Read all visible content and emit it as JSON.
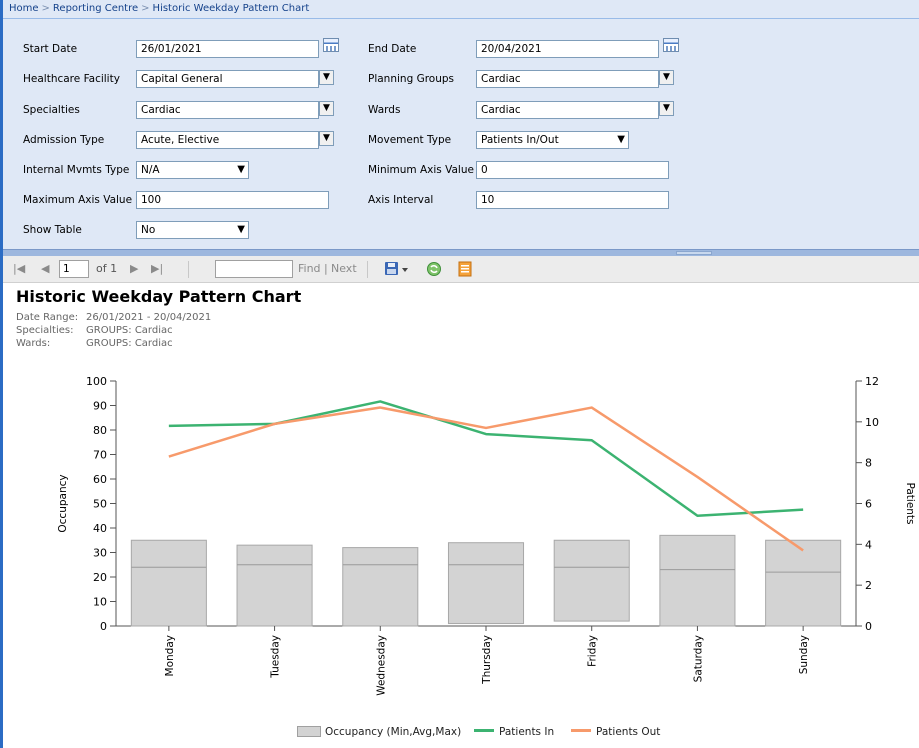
{
  "breadcrumb": [
    "Home",
    "Reporting Centre",
    "Historic Weekday Pattern Chart"
  ],
  "params": {
    "start_date": {
      "label": "Start Date",
      "value": "26/01/2021"
    },
    "end_date": {
      "label": "End Date",
      "value": "20/04/2021"
    },
    "healthcare_facility": {
      "label": "Healthcare Facility",
      "value": "Capital General"
    },
    "planning_groups": {
      "label": "Planning Groups",
      "value": "Cardiac"
    },
    "specialties": {
      "label": "Specialties",
      "value": "Cardiac"
    },
    "wards": {
      "label": "Wards",
      "value": "Cardiac"
    },
    "admission_type": {
      "label": "Admission Type",
      "value": "Acute, Elective"
    },
    "movement_type": {
      "label": "Movement Type",
      "value": "Patients In/Out"
    },
    "internal_mvmts_type": {
      "label": "Internal Mvmts Type",
      "value": "N/A"
    },
    "minimum_axis_value": {
      "label": "Minimum Axis Value",
      "value": "0"
    },
    "maximum_axis_value": {
      "label": "Maximum Axis Value",
      "value": "100"
    },
    "axis_interval": {
      "label": "Axis Interval",
      "value": "10"
    },
    "show_table": {
      "label": "Show Table",
      "value": "No"
    }
  },
  "toolbar": {
    "page_value": "1",
    "page_of": "of 1",
    "find_value": "",
    "find_label": "Find",
    "next_label": "Next"
  },
  "report": {
    "title": "Historic Weekday Pattern Chart",
    "meta": [
      {
        "label": "Date Range:",
        "value": "26/01/2021 - 20/04/2021"
      },
      {
        "label": "Specialties:",
        "value": "GROUPS: Cardiac"
      },
      {
        "label": "Wards:",
        "value": "GROUPS: Cardiac"
      }
    ]
  },
  "chart_data": {
    "type": "bar",
    "categories": [
      "Monday",
      "Tuesday",
      "Wednesday",
      "Thursday",
      "Friday",
      "Saturday",
      "Sunday"
    ],
    "ylabel": "Occupancy",
    "y2label": "Patients",
    "ylim": [
      0,
      100
    ],
    "yticks": [
      0,
      10,
      20,
      30,
      40,
      50,
      60,
      70,
      80,
      90,
      100
    ],
    "y2lim": [
      0,
      12
    ],
    "y2ticks": [
      0,
      2,
      4,
      6,
      8,
      10,
      12
    ],
    "occupancy": {
      "name": "Occupancy (Min,Avg,Max)",
      "color": "#d3d3d3",
      "min": [
        0,
        0,
        0,
        1,
        2,
        0,
        0
      ],
      "avg": [
        24,
        25,
        25,
        25,
        24,
        23,
        22
      ],
      "max": [
        35,
        33,
        32,
        34,
        35,
        37,
        35
      ]
    },
    "series": [
      {
        "name": "Patients In",
        "axis": "right",
        "color": "#3cb371",
        "values": [
          9.8,
          9.9,
          11.0,
          9.4,
          9.1,
          5.4,
          5.7
        ]
      },
      {
        "name": "Patients Out",
        "axis": "right",
        "color": "#f79a6b",
        "values": [
          8.3,
          9.9,
          10.7,
          9.7,
          10.7,
          7.3,
          3.7
        ]
      }
    ],
    "grid": false,
    "legend": "bottom"
  }
}
